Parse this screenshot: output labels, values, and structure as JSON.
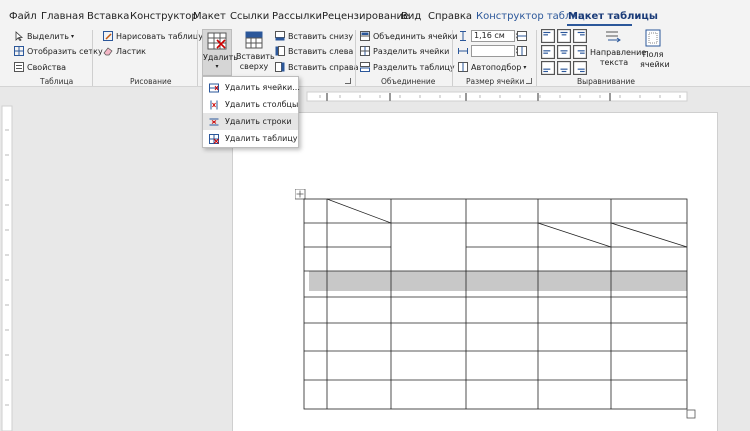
{
  "menu": {
    "tabs": [
      "Файл",
      "Главная",
      "Вставка",
      "Конструктор",
      "Макет",
      "Ссылки",
      "Рассылки",
      "Рецензирование",
      "Вид",
      "Справка",
      "Конструктор таблиц",
      "Макет таблицы"
    ],
    "active_tab": "Макет таблицы"
  },
  "ribbon": {
    "table": {
      "select": "Выделить",
      "gridlines": "Отобразить сетку",
      "properties": "Свойства",
      "label": "Таблица"
    },
    "draw": {
      "draw_table": "Нарисовать таблицу",
      "eraser": "Ластик",
      "label": "Рисование"
    },
    "delete_label": "Удалить",
    "insert": {
      "above": "Вставить сверху",
      "below": "Вставить снизу",
      "left": "Вставить слева",
      "right": "Вставить справа"
    },
    "merge": {
      "merge_cells": "Объединить ячейки",
      "split_cells": "Разделить ячейки",
      "split_table": "Разделить таблицу",
      "label": "Объединение"
    },
    "cell_size": {
      "height": "1,16 см",
      "autofit": "Автоподбор",
      "label": "Размер ячейки"
    },
    "alignment": {
      "text_direction": "Направление текста",
      "margins": "Поля ячейки",
      "label": "Выравнивание"
    }
  },
  "dropdown": {
    "items": [
      "Удалить ячейки...",
      "Удалить столбцы",
      "Удалить строки",
      "Удалить таблицу"
    ],
    "highlighted": "Удалить строки"
  },
  "colors": {
    "accent": "#2b579a",
    "selected_row": "#c8c8c8"
  }
}
